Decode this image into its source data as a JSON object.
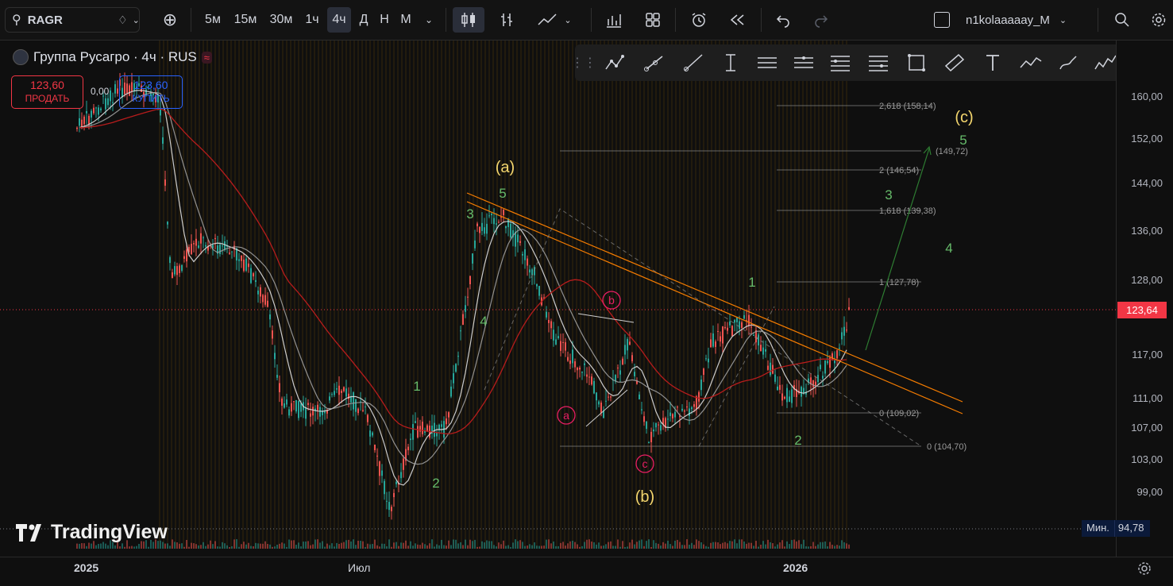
{
  "toolbar": {
    "symbol": "RAGR",
    "intervals": [
      "5м",
      "15м",
      "30м",
      "1ч",
      "4ч",
      "Д",
      "Н",
      "М"
    ],
    "active_interval": "4ч",
    "username": "n1kolaaaaay_M"
  },
  "legend": {
    "title": "Группа Русагро · 4ч · RUS",
    "sell_price": "123,60",
    "sell_label": "ПРОДАТЬ",
    "spread": "0,00",
    "buy_price": "123,60",
    "buy_label": "КУПИТЬ"
  },
  "price_axis": {
    "labels": [
      "160,00",
      "152,00",
      "144,00",
      "136,00",
      "128,00",
      "117,00",
      "111,00",
      "107,00",
      "103,00",
      "99,00"
    ],
    "current_price": "123,64",
    "min_label": "Мин.",
    "min_value": "94,78"
  },
  "time_axis": {
    "labels": [
      "2025",
      "Июл",
      "2026"
    ]
  },
  "fib_labels": [
    "2,618 (158,14)",
    "(149,72)",
    "2 (146,54)",
    "1,618 (139,38)",
    "1 (127,78)",
    "0 (109,02)",
    "0 (104,70)"
  ],
  "wave_labels": {
    "yellow": [
      "(a)",
      "(b)",
      "(c)"
    ],
    "green": [
      "1",
      "2",
      "3",
      "4",
      "5",
      "1",
      "2",
      "3",
      "4",
      "5"
    ],
    "pink": [
      "a",
      "b",
      "c"
    ]
  },
  "branding": "TradingView",
  "colors": {
    "background": "#0f0f0f",
    "bull": "#26a69a",
    "bear": "#ef5350",
    "wave_yellow": "#f5d76e",
    "wave_green": "#66bb6a",
    "wave_pink": "#e91e63",
    "trendline": "#f57c00",
    "ma_red": "#b71c1c"
  }
}
